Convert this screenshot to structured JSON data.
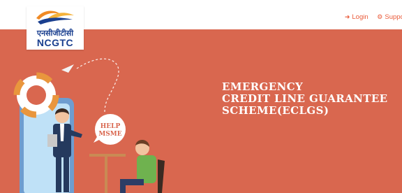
{
  "logo": {
    "hindi_text": "एनसीजीटीसी",
    "text": "NCGTC",
    "icon": "ncgtc-swoosh-logo"
  },
  "nav": {
    "login_label": "Login",
    "login_icon": "sign-in-icon",
    "support_label": "Suppor",
    "support_icon": "gear-icon"
  },
  "hero": {
    "title_line1": "EMERGENCY",
    "title_line2": "CREDIT LINE GUARANTEE",
    "title_line3": "SCHEME(ECLGS)",
    "badge_line1": "HELP",
    "badge_line2": "MSME"
  },
  "colors": {
    "accent": "#ea5b3a",
    "hero_bg": "#d9674f",
    "brand_blue": "#1a3f8f",
    "brand_orange": "#f08a24"
  }
}
